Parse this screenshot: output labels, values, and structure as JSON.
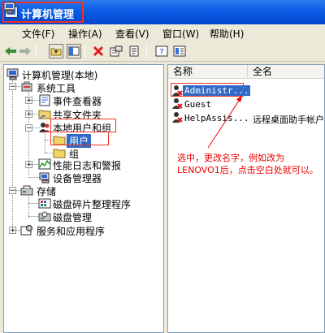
{
  "window": {
    "title": "计算机管理"
  },
  "menu": [
    {
      "label": "文件(F)"
    },
    {
      "label": "操作(A)"
    },
    {
      "label": "查看(V)"
    },
    {
      "label": "窗口(W)"
    },
    {
      "label": "帮助(H)"
    }
  ],
  "tree": {
    "root": "计算机管理(本地)",
    "system_tools": "系统工具",
    "event_viewer": "事件查看器",
    "shared_folders": "共享文件夹",
    "local_users_groups": "本地用户和组",
    "users": "用户",
    "groups": "组",
    "perf_logs": "性能日志和警报",
    "device_manager": "设备管理器",
    "storage": "存储",
    "defrag": "磁盘碎片整理程序",
    "disk_mgmt": "磁盘管理",
    "services_apps": "服务和应用程序"
  },
  "list": {
    "columns": [
      "名称",
      "全名"
    ],
    "rows": [
      {
        "name": "Administr...",
        "fullname": ""
      },
      {
        "name": "Guest",
        "fullname": ""
      },
      {
        "name": "HelpAssis...",
        "fullname": "远程桌面助手帐户"
      }
    ]
  },
  "annotation": {
    "line1": "选中，更改名字，例如改为",
    "line2": "LENOVO1后，点击空白处就可以。"
  },
  "colors": {
    "annotation": "#e00000",
    "title_bar": "#0a5ce4",
    "highlight": "#316ac5"
  }
}
